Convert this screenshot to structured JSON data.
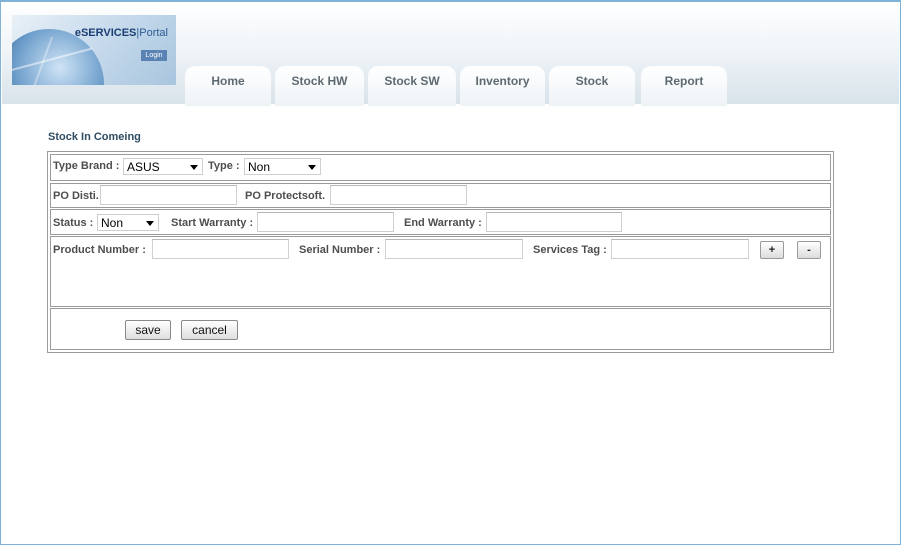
{
  "header": {
    "logo_title": "eSERVICES",
    "logo_subtitle": "Portal",
    "login_label": "Login"
  },
  "tabs": [
    {
      "label": "Home"
    },
    {
      "label": "Stock HW"
    },
    {
      "label": "Stock SW"
    },
    {
      "label": "Inventory"
    },
    {
      "label": "Stock"
    },
    {
      "label": "Report"
    }
  ],
  "page_title": "Stock In Comeing",
  "form": {
    "type_brand_label": "Type Brand :",
    "type_brand_value": "ASUS",
    "type_label": "Type :",
    "type_value": "Non",
    "po_disti_label": "PO Disti.",
    "po_disti_value": "",
    "po_protectsoft_label": "PO Protectsoft.",
    "po_protectsoft_value": "",
    "status_label": "Status :",
    "status_value": "Non",
    "start_warranty_label": "Start Warranty :",
    "start_warranty_value": "",
    "end_warranty_label": "End Warranty :",
    "end_warranty_value": "",
    "product_number_label": "Product Number :",
    "product_number_value": "",
    "serial_number_label": "Serial Number :",
    "serial_number_value": "",
    "services_tag_label": "Services Tag :",
    "services_tag_value": "",
    "add_label": "+",
    "remove_label": "-",
    "save_label": "save",
    "cancel_label": "cancel"
  }
}
